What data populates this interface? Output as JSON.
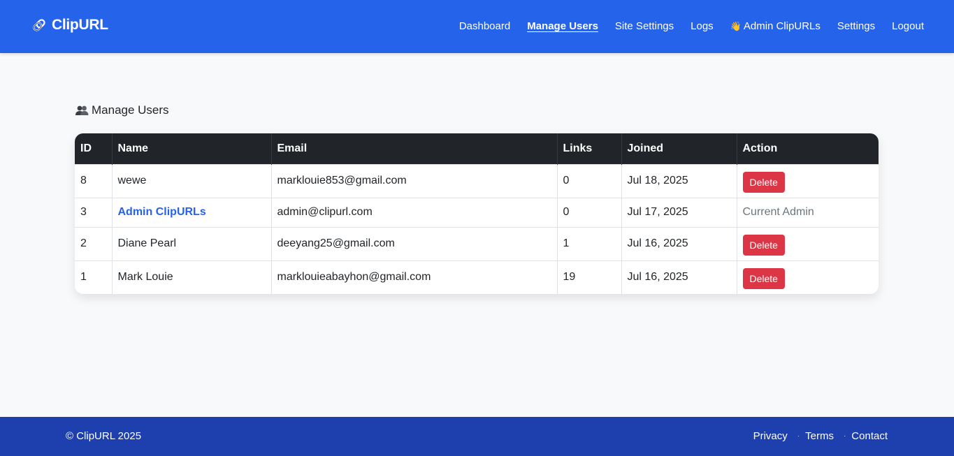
{
  "app": {
    "name": "ClipURL"
  },
  "nav": {
    "items": [
      {
        "label": "Dashboard",
        "active": false
      },
      {
        "label": "Manage Users",
        "active": true
      },
      {
        "label": "Site Settings",
        "active": false
      },
      {
        "label": "Logs",
        "active": false
      },
      {
        "label": "Admin ClipURLs",
        "active": false,
        "icon": "waving-hand-icon"
      },
      {
        "label": "Settings",
        "active": false
      },
      {
        "label": "Logout",
        "active": false
      }
    ]
  },
  "page": {
    "title": "Manage Users",
    "title_icon": "users-icon"
  },
  "table": {
    "headers": [
      "ID",
      "Name",
      "Email",
      "Links",
      "Joined",
      "Action"
    ],
    "rows": [
      {
        "id": "8",
        "name": "wewe",
        "email": "marklouie853@gmail.com",
        "links": "0",
        "joined": "Jul 18, 2025",
        "action": "Delete"
      },
      {
        "id": "3",
        "name": "Admin ClipURLs",
        "email": "admin@clipurl.com",
        "links": "0",
        "joined": "Jul 17, 2025",
        "action": "Current Admin"
      },
      {
        "id": "2",
        "name": "Diane Pearl",
        "email": "deeyang25@gmail.com",
        "links": "1",
        "joined": "Jul 16, 2025",
        "action": "Delete"
      },
      {
        "id": "1",
        "name": "Mark Louie",
        "email": "marklouieabayhon@gmail.com",
        "links": "19",
        "joined": "Jul 16, 2025",
        "action": "Delete"
      }
    ]
  },
  "footer": {
    "copyright": "© ClipURL 2025",
    "links": [
      "Privacy",
      "Terms",
      "Contact"
    ],
    "separator": "·"
  },
  "colors": {
    "primary": "#2563eb",
    "footer": "#1e40af",
    "danger": "#dc3545",
    "table_header": "#212529"
  }
}
